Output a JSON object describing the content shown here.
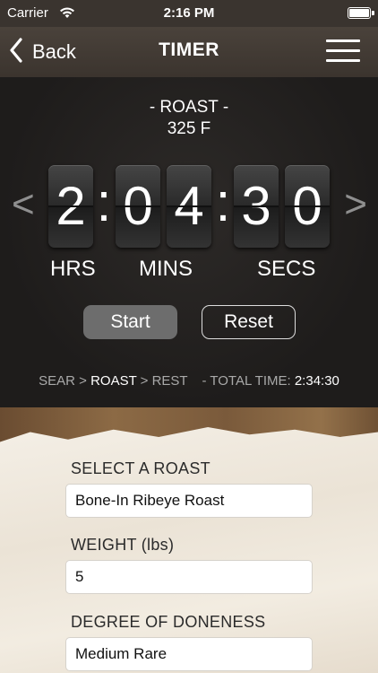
{
  "status": {
    "carrier": "Carrier",
    "time": "2:16 PM"
  },
  "nav": {
    "back_label": "Back",
    "title": "TIMER"
  },
  "timer": {
    "phase": "- ROAST -",
    "temperature": "325 F",
    "digits": [
      "2",
      "0",
      "4",
      "3",
      "0"
    ],
    "colon": ":",
    "units": {
      "hrs": "HRS",
      "mins": "MINS",
      "secs": "SECS"
    },
    "prev_arrow": "<",
    "next_arrow": ">"
  },
  "controls": {
    "start_label": "Start",
    "reset_label": "Reset"
  },
  "progress": {
    "steps": [
      "SEAR",
      "ROAST",
      "REST"
    ],
    "separator": ">",
    "current_step": "ROAST",
    "total_label": "- TOTAL TIME:",
    "total_value": "2:34:30"
  },
  "form": {
    "roast_label": "SELECT A ROAST",
    "roast_value": "Bone-In Ribeye Roast",
    "weight_label": "WEIGHT (lbs)",
    "weight_value": "5",
    "doneness_label": "DEGREE OF DONENESS",
    "doneness_value": "Medium Rare"
  },
  "colors": {
    "accent_button": "#6d6d6d",
    "panel_bg": "#1f1d1c",
    "nav_bg": "#443c35"
  },
  "icons": {
    "back": "chevron-left-icon",
    "menu": "hamburger-menu-icon",
    "wifi": "wifi-icon",
    "battery": "battery-icon"
  }
}
